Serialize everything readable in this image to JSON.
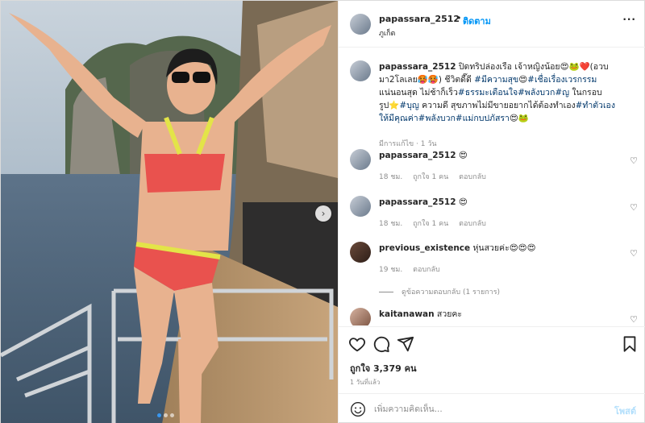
{
  "post": {
    "username": "papassara_2512",
    "separator": "•",
    "follow_label": "ติดตาม",
    "location": "ภูเก็ต",
    "more_label": "···"
  },
  "caption": {
    "username": "papassara_2512",
    "part1": " ปิดทริปล่องเรือ เจ้าหญิงน้อย😍🐸❤️(อวบมา2โลเลย🥵🥵) ชีวิตดี๊ดี ",
    "tag1": "#มีความสุข",
    "part2": "😍",
    "tag2": "#เชื่อเรื่องเวรกรรม",
    "part3": " แน่นอนสุด ไม่ช้าก็เร็ว",
    "tag3": "#ธรรมะเตือนใจ",
    "tag4": "#พลังบวก",
    "tag5": "#ญ",
    "part4": " ในกรอบรูป⭐",
    "tag6": "#บุญ",
    "part5": " ความดี สุขภาพไม่มีขายอยากได้ต้องทำเอง",
    "tag7": "#ทำตัวเองให้มีคุณค่า",
    "tag8": "#พลังบวก",
    "tag9": "#แม่กบปภัสรา",
    "part6": "😍🐸",
    "meta": "มีการแก้ไข · 1 วัน"
  },
  "comments": [
    {
      "username": "papassara_2512",
      "text": " 😍",
      "time": "18 ชม.",
      "likes": "ถูกใจ 1 คน",
      "reply": "ตอบกลับ"
    },
    {
      "username": "papassara_2512",
      "text": " 😍",
      "time": "18 ชม.",
      "likes": "ถูกใจ 1 คน",
      "reply": "ตอบกลับ"
    },
    {
      "username": "previous_existence",
      "text": " หุ่นสวยค่ะ😍😍😍",
      "time": "19 ชม.",
      "reply": "ตอบกลับ"
    },
    {
      "username": "kaitanawan",
      "text": " สวยคะ"
    }
  ],
  "view_replies": "ดูข้อความตอบกลับ (1 รายการ)",
  "heart_glyph": "♡",
  "stats": {
    "likes": "ถูกใจ 3,379 คน",
    "posted": "1 วันที่แล้ว"
  },
  "composer": {
    "placeholder": "เพิ่มความคิดเห็น...",
    "post_label": "โพสต์"
  },
  "carousel": {
    "next": "›",
    "slide_count": 3,
    "active_index": 0
  },
  "colors": {
    "accent": "#0095f6",
    "post_disabled": "#b2dffc",
    "hashtag": "#00376b"
  }
}
